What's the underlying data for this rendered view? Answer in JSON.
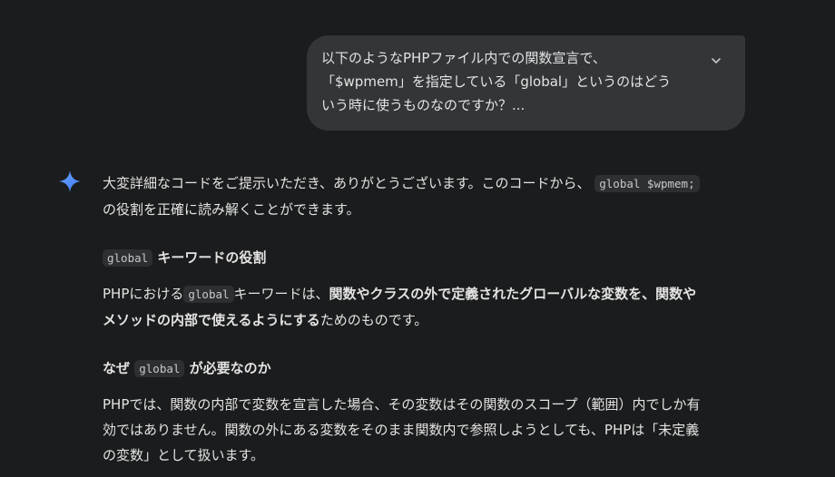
{
  "user_message": {
    "lines": [
      "以下のようなPHPファイル内での関数宣言で、",
      "「$wpmem」を指定している「global」というのはどう",
      "いう時に使うものなのですか？..."
    ],
    "expand_icon": "chevron-down-icon"
  },
  "response": {
    "icon": "sparkle-icon",
    "colors": {
      "sparkle": "#4a8cf7",
      "bubble": "#333537",
      "background": "#1b1c1d"
    },
    "intro": {
      "text_before": "大変詳細なコードをご提示いただき、ありがとうございます。このコードから、",
      "code": "global $wpmem;",
      "line2": "の役割を正確に読み解くことができます。"
    },
    "section1": {
      "heading_code": "global",
      "heading_text": "キーワードの役割",
      "p_prefix": "PHPにおける",
      "p_code": "global",
      "p_mid": "キーワードは、",
      "p_bold1": "関数やクラスの外で定義されたグローバルな変数を、関数や",
      "p_bold2": "メソッドの内部で使えるようにする",
      "p_suffix": "ためのものです。"
    },
    "section2": {
      "heading_prefix": "なぜ",
      "heading_code": "global",
      "heading_suffix": "が必要なのか",
      "lines": [
        "PHPでは、関数の内部で変数を宣言した場合、その変数はその関数のスコープ（範囲）内でしか有",
        "効ではありません。関数の外にある変数をそのまま関数内で参照しようとしても、PHPは「未定義",
        "の変数」として扱います。"
      ]
    }
  }
}
